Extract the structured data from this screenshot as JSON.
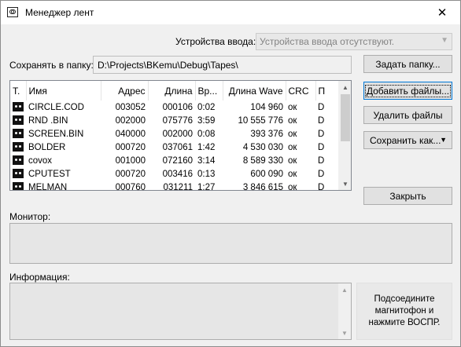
{
  "window": {
    "title": "Менеджер лент",
    "close_glyph": "✕"
  },
  "input_device": {
    "label": "Устройства ввода:",
    "value": "Устройства ввода отсутствуют."
  },
  "save_folder": {
    "label": "Сохранять в папку:",
    "value": "D:\\Projects\\BKemu\\Debug\\Tapes\\"
  },
  "buttons": {
    "set_folder": "Задать папку...",
    "add_files": "Добавить файлы...",
    "delete_files": "Удалить файлы",
    "save_as": "Сохранить как...",
    "close": "Закрыть"
  },
  "table": {
    "columns": [
      "Т.",
      "Имя",
      "Адрес",
      "Длина",
      "Вр...",
      "Длина Wave",
      "CRC",
      "П"
    ],
    "rows": [
      {
        "icon": "tape-icon",
        "name": "CIRCLE.COD",
        "addr": "003052",
        "len": "000106",
        "time": "0:02",
        "wave": "104 960",
        "crc": "ок",
        "p": "D"
      },
      {
        "icon": "tape-icon",
        "name": "RND   .BIN",
        "addr": "002000",
        "len": "075776",
        "time": "3:59",
        "wave": "10 555 776",
        "crc": "ок",
        "p": "D"
      },
      {
        "icon": "tape-icon",
        "name": "SCREEN.BIN",
        "addr": "040000",
        "len": "002000",
        "time": "0:08",
        "wave": "393 376",
        "crc": "ок",
        "p": "D"
      },
      {
        "icon": "tape-icon",
        "name": "BOLDER",
        "addr": "000720",
        "len": "037061",
        "time": "1:42",
        "wave": "4 530 030",
        "crc": "ок",
        "p": "D"
      },
      {
        "icon": "tape-icon",
        "name": "covox",
        "addr": "001000",
        "len": "072160",
        "time": "3:14",
        "wave": "8 589 330",
        "crc": "ок",
        "p": "D"
      },
      {
        "icon": "tape-icon",
        "name": "CPUTEST",
        "addr": "000720",
        "len": "003416",
        "time": "0:13",
        "wave": "600 090",
        "crc": "ок",
        "p": "D"
      },
      {
        "icon": "tape-icon",
        "name": "MELMAN",
        "addr": "000760",
        "len": "031211",
        "time": "1:27",
        "wave": "3 846 615",
        "crc": "ок",
        "p": "D"
      }
    ]
  },
  "monitor": {
    "label": "Монитор:"
  },
  "info": {
    "label": "Информация:"
  },
  "hint": {
    "text": "Подсоедините магнитофон и нажмите ВОСПР."
  },
  "colors": {
    "window_bg": "#f0f0f0",
    "focus_border": "#0078d7"
  }
}
